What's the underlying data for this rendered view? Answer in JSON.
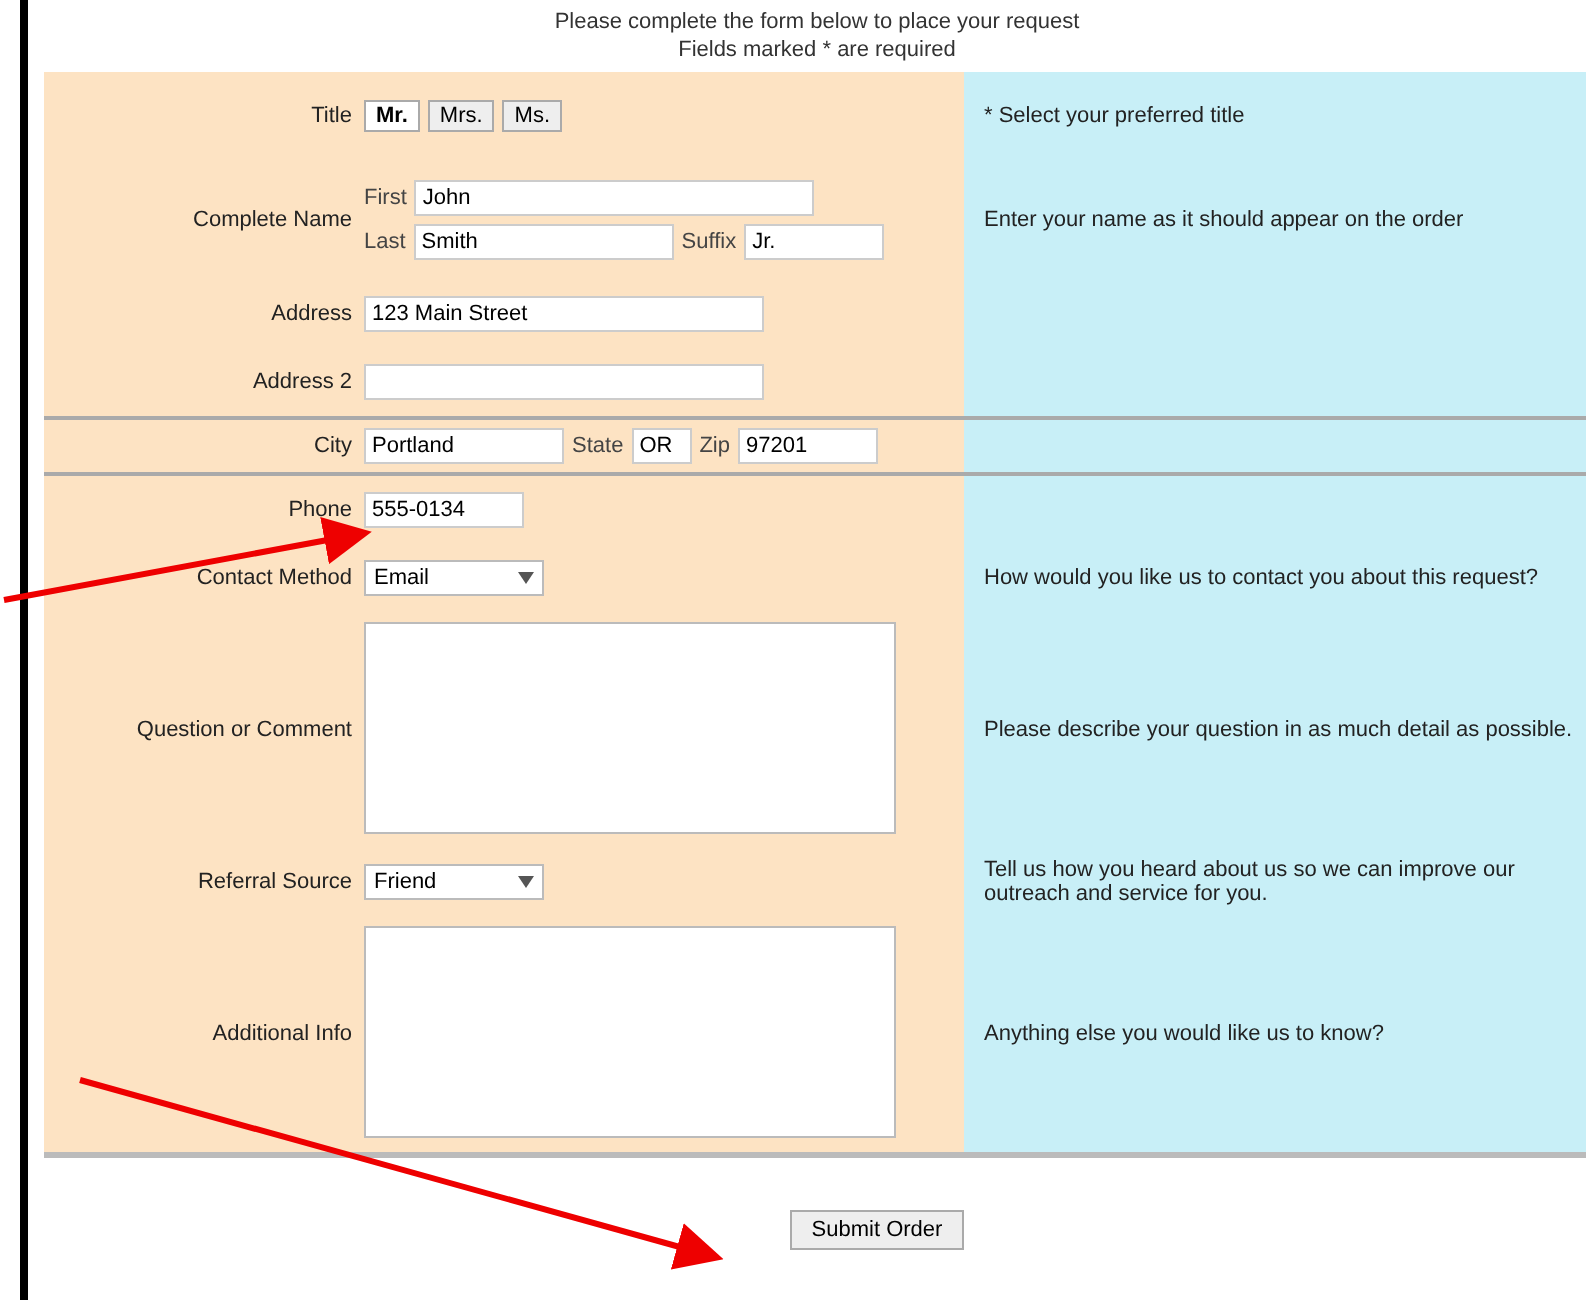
{
  "header": {
    "title": "Please complete the form below to place your request",
    "subtitle": "Fields marked * are required"
  },
  "rows": [
    {
      "kind": "radio",
      "label": "Title",
      "hint": "* Select your preferred title",
      "options": [
        {
          "label": "Mr.",
          "selected": true
        },
        {
          "label": "Mrs.",
          "selected": false
        },
        {
          "label": "Ms.",
          "selected": false
        }
      ]
    },
    {
      "kind": "name",
      "label": "Complete Name",
      "hint": "Enter your name as it should appear on the order",
      "fields": [
        {
          "label": "First",
          "value": "John"
        },
        {
          "label": "Last",
          "value": "Smith"
        },
        {
          "label": "Suffix",
          "value": "Jr."
        }
      ]
    },
    {
      "kind": "text",
      "label": "Address",
      "value": "123 Main Street"
    },
    {
      "kind": "text",
      "label": "Address 2",
      "value": ""
    },
    {
      "kind": "fields",
      "label": "City",
      "fields": [
        {
          "value": "Portland"
        },
        {
          "label": "State",
          "value": "OR"
        },
        {
          "label": "Zip",
          "value": "97201"
        }
      ]
    },
    {
      "kind": "text",
      "label": "Phone",
      "value": "555-0134",
      "short": true
    },
    {
      "kind": "select",
      "label": "Contact Method",
      "value": "Email",
      "hint": "How would you like us to contact you about this request?"
    },
    {
      "kind": "textarea",
      "label": "Question or Comment",
      "hint": "Please describe your question in as much detail as possible."
    },
    {
      "kind": "select",
      "label": "Referral Source",
      "value": "Friend",
      "hint": "Tell us how you heard about us so we can improve our outreach and service for you."
    },
    {
      "kind": "textarea",
      "label": "Additional Info",
      "hint": "Anything else you would like us to know?"
    }
  ],
  "button": "Submit Order"
}
